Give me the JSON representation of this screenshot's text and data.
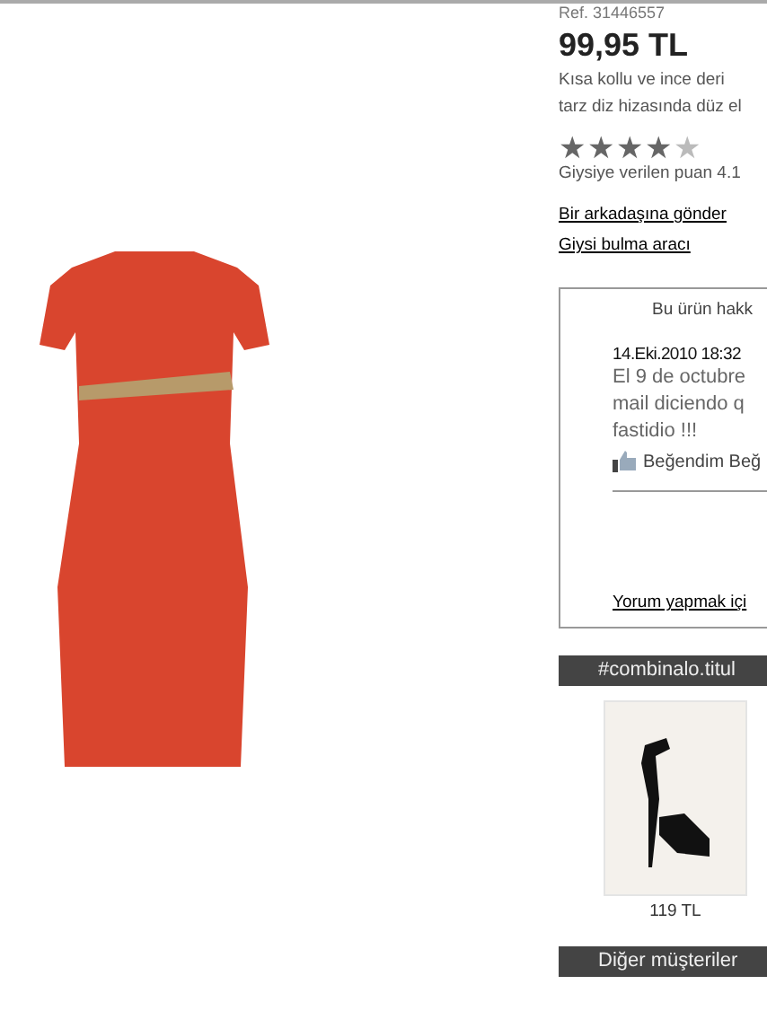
{
  "product": {
    "reference": "Ref. 31446557",
    "price": "99,95 TL",
    "description": [
      "Kısa kollu ve ince deri",
      "tarz diz hizasında düz el"
    ],
    "stars": 4,
    "rating_text": "Giysiye verilen puan 4.1",
    "links": [
      "Bir arkadaşına gönder",
      "Giysi bulma aracı"
    ]
  },
  "reviews": {
    "title": "Bu ürün hakk",
    "date": "14.Eki.2010 18:32",
    "text": [
      "El 9 de octubre",
      "mail diciendo q",
      "fastidio !!!"
    ],
    "like": "Beğendim Beğ",
    "comment_link": "Yorum yapmak içi"
  },
  "combination": {
    "title": "#combinalo.titul",
    "items": [
      {
        "price": "119 TL"
      }
    ]
  },
  "others": {
    "title": "Diğer müşteriler"
  }
}
